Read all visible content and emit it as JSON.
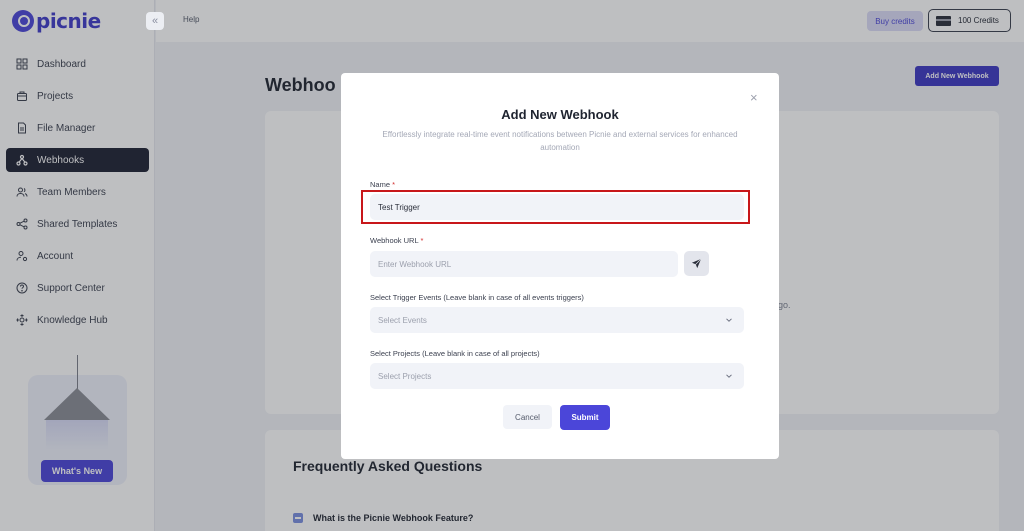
{
  "app": {
    "logo_text": "picnie"
  },
  "topbar": {
    "help": "Help",
    "buy_credits": "Buy credits",
    "credits": "100 Credits"
  },
  "sidebar": {
    "items": [
      {
        "label": "Dashboard",
        "icon": "dashboard-icon"
      },
      {
        "label": "Projects",
        "icon": "projects-icon"
      },
      {
        "label": "File Manager",
        "icon": "file-icon"
      },
      {
        "label": "Webhooks",
        "icon": "webhook-icon",
        "active": true
      },
      {
        "label": "Team Members",
        "icon": "team-icon"
      },
      {
        "label": "Shared Templates",
        "icon": "share-icon"
      },
      {
        "label": "Account",
        "icon": "account-icon"
      },
      {
        "label": "Support Center",
        "icon": "help-circle-icon"
      },
      {
        "label": "Knowledge Hub",
        "icon": "knowledge-icon"
      }
    ],
    "whats_new": "What's New"
  },
  "main": {
    "title": "Webhoo",
    "add_button": "Add New Webhook",
    "panel_text_fragment": "go.",
    "faq_title": "Frequently Asked Questions",
    "faq_items": [
      {
        "question": "What is the Picnie Webhook Feature?"
      }
    ]
  },
  "modal": {
    "close": "×",
    "title": "Add New Webhook",
    "subtitle": "Effortlessly integrate real-time event notifications between Picnie and external services for enhanced automation",
    "name_label": "Name",
    "name_value": "Test Trigger",
    "url_label": "Webhook URL",
    "url_placeholder": "Enter Webhook URL",
    "events_label": "Select Trigger Events (Leave blank in case of all events triggers)",
    "events_placeholder": "Select Events",
    "projects_label": "Select Projects (Leave blank in case of all projects)",
    "projects_placeholder": "Select Projects",
    "required_mark": "*",
    "cancel": "Cancel",
    "submit": "Submit"
  },
  "colors": {
    "accent": "#4b46d9",
    "active_nav": "#1e2233",
    "highlight": "#c8171a"
  }
}
